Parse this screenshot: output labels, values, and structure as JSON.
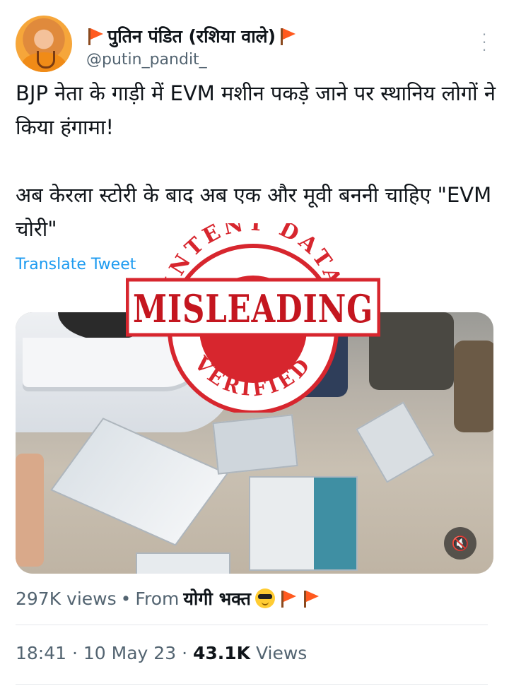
{
  "header": {
    "display_name": "पुतिन पंडित (रशिया वाले)",
    "handle": "@putin_pandit_",
    "flag_icon": "saffron-flag-icon",
    "more_icon": "vertical-ellipsis-icon"
  },
  "tweet": {
    "text": "BJP नेता के गाड़ी में EVM मशीन पकड़े जाने पर स्थानिय लोगों ने किया हंगामा!\n\nअब केरला स्टोरी के बाद अब एक और मूवी बननी चाहिए \"EVM चोरी\"",
    "translate_label": "Translate Tweet"
  },
  "stamp": {
    "top_text": "INTENT DATA",
    "middle_text": "MISLEADING",
    "bottom_text": "VERIFIED",
    "color": "#d7262e"
  },
  "media": {
    "mute_icon": "speaker-muted-icon"
  },
  "footer": {
    "video_views": "297K views",
    "separator": "•",
    "from_label": "From",
    "from_name": "योगी भक्त",
    "from_emoji_icon": "sunglasses-emoji-icon",
    "time": "18:41",
    "dot": "·",
    "date": "10 May 23",
    "views_count": "43.1K",
    "views_label": "Views"
  },
  "colors": {
    "link": "#1d9bf0",
    "secondary_text": "#536471",
    "primary_text": "#0f1419"
  }
}
